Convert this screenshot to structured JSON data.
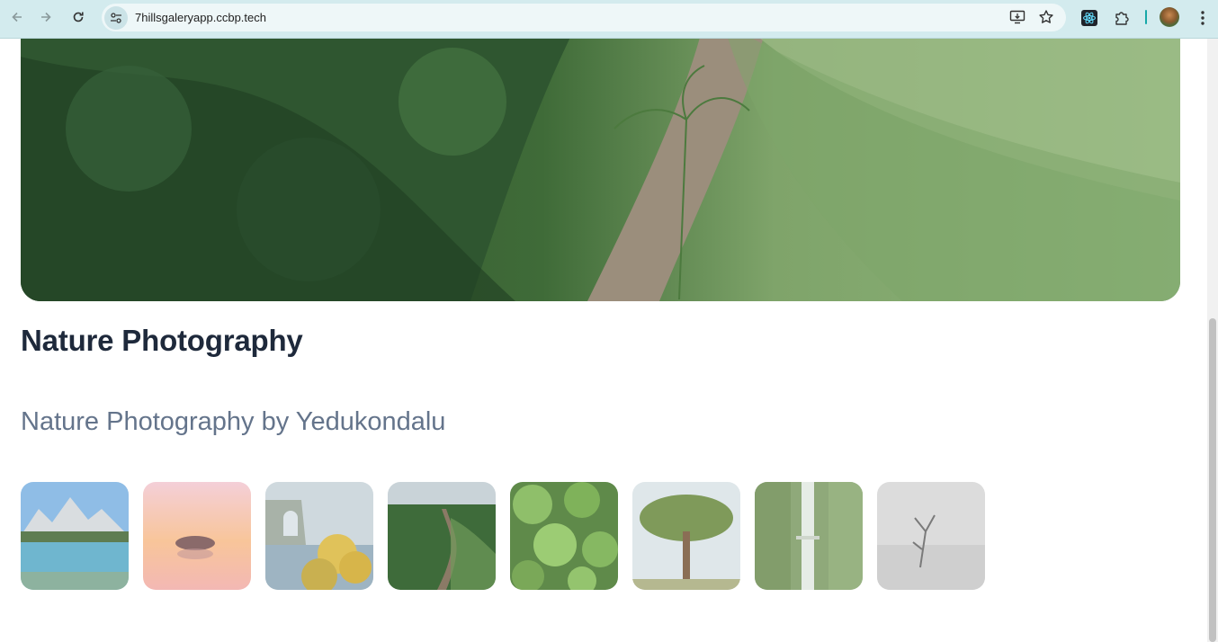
{
  "browser": {
    "url": "7hillsgaleryapp.ccbp.tech",
    "icons": {
      "back": "back-arrow-icon",
      "forward": "forward-arrow-icon",
      "reload": "reload-icon",
      "site_info": "site-settings-icon",
      "install": "install-app-icon",
      "bookmark": "star-icon",
      "react_ext": "react-devtools-icon",
      "extensions": "puzzle-icon",
      "profile": "avatar",
      "menu": "kebab-menu-icon"
    }
  },
  "page": {
    "title": "Nature Photography",
    "subtitle": "Nature Photography by Yedukondalu",
    "thumbnails": [
      {
        "name": "lake-mountains"
      },
      {
        "name": "sunset-island"
      },
      {
        "name": "sea-cliff-flowers"
      },
      {
        "name": "hill-path"
      },
      {
        "name": "green-leaves"
      },
      {
        "name": "lone-tree"
      },
      {
        "name": "waterfall"
      },
      {
        "name": "misty-tree"
      }
    ]
  },
  "colors": {
    "chrome_bg": "#d3ebee",
    "heading": "#1e293b",
    "subheading": "#64748b"
  }
}
